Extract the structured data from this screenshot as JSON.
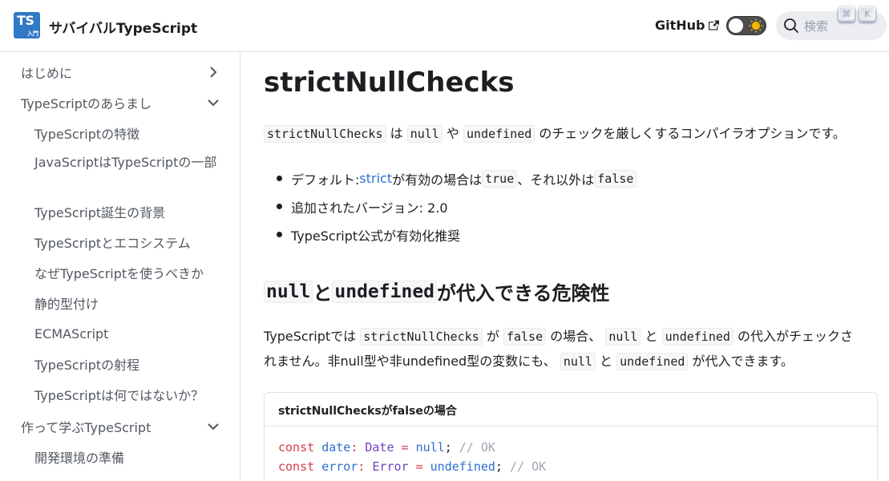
{
  "navbar": {
    "logo_main": "TS",
    "logo_sub": "入門",
    "title": "サバイバルTypeScript",
    "github_label": "GitHub",
    "search_placeholder": "検索",
    "kbd_cmd": "⌘",
    "kbd_k": "K"
  },
  "sidebar": {
    "items": [
      {
        "label": "はじめに",
        "chevron": "right"
      },
      {
        "label": "TypeScriptのあらまし",
        "chevron": "down"
      },
      {
        "label": "TypeScriptの特徴"
      },
      {
        "label": "JavaScriptはTypeScriptの一部"
      },
      {
        "label": "TypeScript誕生の背景"
      },
      {
        "label": "TypeScriptとエコシステム"
      },
      {
        "label": "なぜTypeScriptを使うべきか"
      },
      {
        "label": "静的型付け"
      },
      {
        "label": "ECMAScript"
      },
      {
        "label": "TypeScriptの射程"
      },
      {
        "label": "TypeScriptは何ではないか？"
      },
      {
        "label": "作って学ぶTypeScript",
        "chevron": "down"
      },
      {
        "label": "開発環境の準備"
      }
    ]
  },
  "main": {
    "title": "strictNullChecks",
    "intro": {
      "code1": "strictNullChecks",
      "t1": "は",
      "code2": "null",
      "t2": "や",
      "code3": "undefined",
      "t3": "のチェックを厳しくするコンパイラオプションです。"
    },
    "bullets": {
      "b1_prefix": "デフォルト: ",
      "b1_link": "strict",
      "b1_mid": "が有効の場合は",
      "b1_code1": "true",
      "b1_mid2": "、それ以外は",
      "b1_code2": "false",
      "b2": "追加されたバージョン: 2.0",
      "b3": "TypeScript公式が有効化推奨"
    },
    "section": {
      "code1": "null",
      "t1": "と",
      "code2": "undefined",
      "t2": "が代入できる危険性"
    },
    "para1": {
      "t1": "TypeScriptでは",
      "code1": "strictNullChecks",
      "t2": "が",
      "code2": "false",
      "t3": "の場合、",
      "code3": "null",
      "t4": "と",
      "code4": "undefined",
      "t5": "の代入がチェックさ"
    },
    "para2": {
      "t1": "れません。非null型や非undefined型の変数にも、",
      "code1": "null",
      "t2": "と",
      "code2": "undefined",
      "t3": "が代入できます。"
    },
    "code_block": {
      "title": "strictNullChecksがfalseの場合",
      "line1": {
        "kw": "const",
        "id": "date",
        "colon": ":",
        "type": "Date",
        "eq": "=",
        "val": "null",
        "semi": ";",
        "comment": "// OK"
      },
      "line2": {
        "kw": "const",
        "id": "error",
        "colon": ":",
        "type": "Error",
        "eq": "=",
        "val": "undefined",
        "semi": ";",
        "comment": "// OK"
      }
    }
  },
  "colors": {
    "accent": "#3178c6",
    "link": "#2e6fd1",
    "keyword": "#d73a49",
    "type": "#6f42c1"
  }
}
